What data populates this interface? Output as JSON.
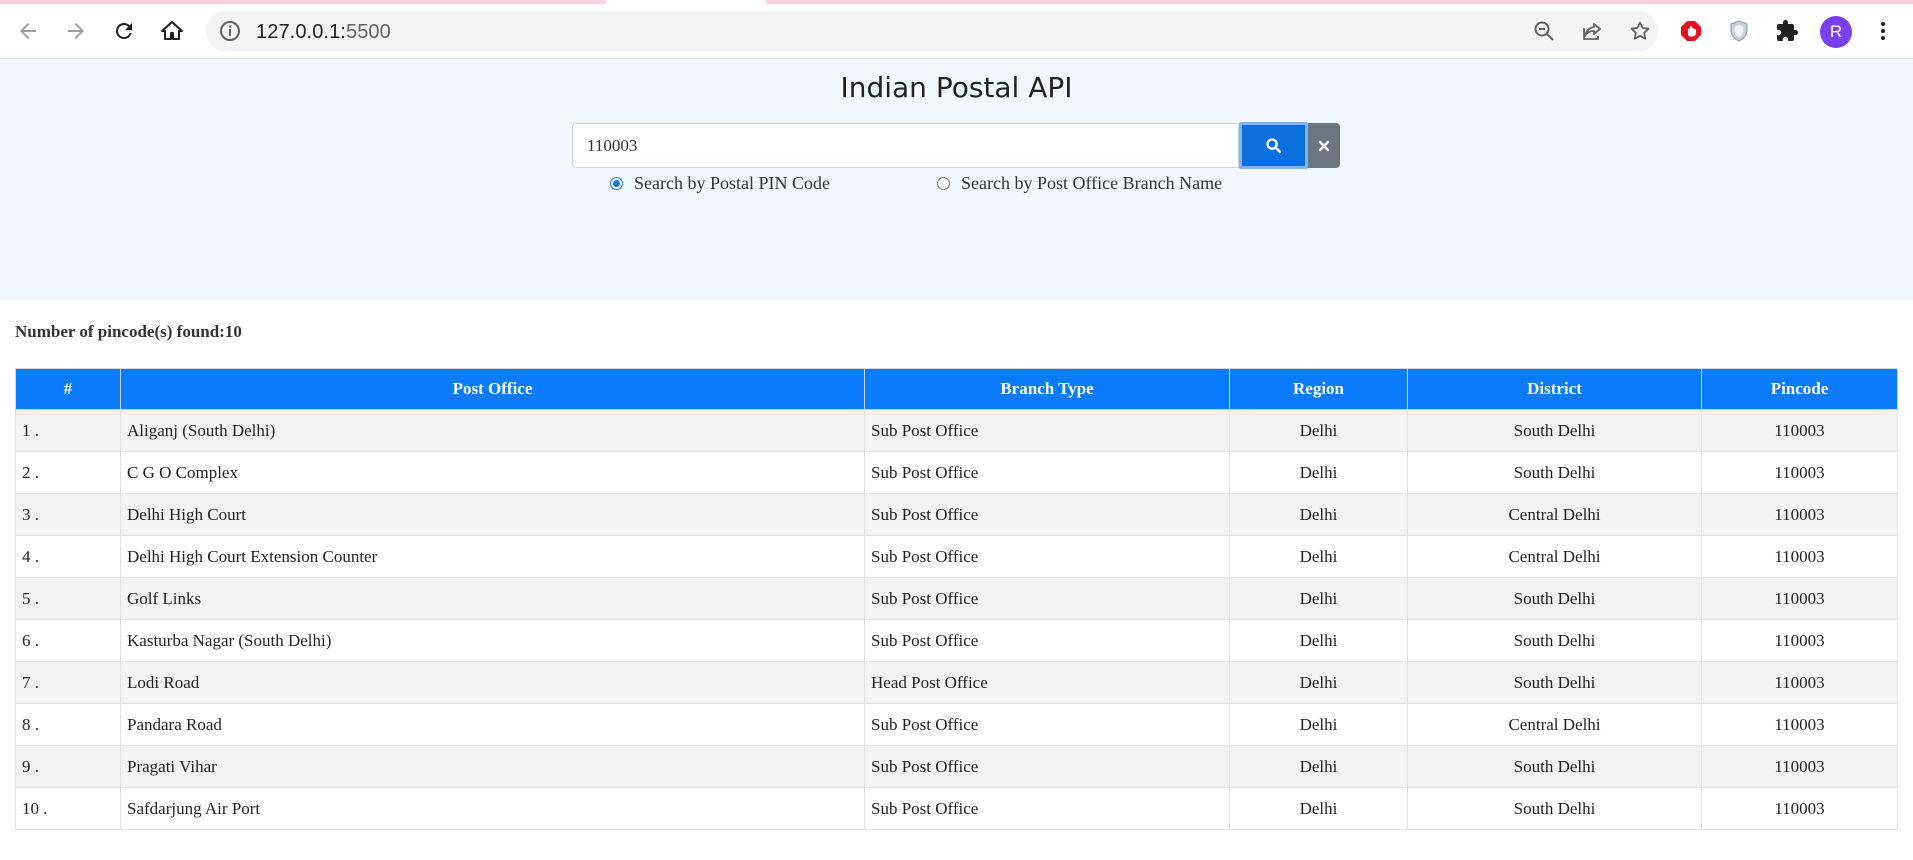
{
  "browser": {
    "url_host": "127.0.0.1:",
    "url_port": "5500",
    "profile_initial": "R",
    "icons": [
      "back-icon",
      "forward-icon",
      "reload-icon",
      "home-icon",
      "site-info-icon",
      "zoom-out-icon",
      "share-icon",
      "bookmark-star-icon",
      "adblock-icon",
      "shield-extension-icon",
      "extensions-puzzle-icon",
      "kebab-menu-icon"
    ],
    "avatar_color": "#7b3ff2"
  },
  "app": {
    "title": "Indian Postal API",
    "search": {
      "value": "110003",
      "placeholder": ""
    },
    "radio_options": [
      {
        "label": "Search by Postal PIN Code",
        "checked": true
      },
      {
        "label": "Search by Post Office Branch Name",
        "checked": false
      }
    ],
    "count_label": "Number of pincode(s) found:",
    "count_value": "10",
    "accent_color": "#0b7bfb"
  },
  "table": {
    "headers": [
      "#",
      "Post Office",
      "Branch Type",
      "Region",
      "District",
      "Pincode"
    ],
    "rows": [
      [
        "1 .",
        "Aliganj (South Delhi)",
        "Sub Post Office",
        "Delhi",
        "South Delhi",
        "110003"
      ],
      [
        "2 .",
        "C G O Complex",
        "Sub Post Office",
        "Delhi",
        "South Delhi",
        "110003"
      ],
      [
        "3 .",
        "Delhi High Court",
        "Sub Post Office",
        "Delhi",
        "Central Delhi",
        "110003"
      ],
      [
        "4 .",
        "Delhi High Court Extension Counter",
        "Sub Post Office",
        "Delhi",
        "Central Delhi",
        "110003"
      ],
      [
        "5 .",
        "Golf Links",
        "Sub Post Office",
        "Delhi",
        "South Delhi",
        "110003"
      ],
      [
        "6 .",
        "Kasturba Nagar (South Delhi)",
        "Sub Post Office",
        "Delhi",
        "South Delhi",
        "110003"
      ],
      [
        "7 .",
        "Lodi Road",
        "Head Post Office",
        "Delhi",
        "South Delhi",
        "110003"
      ],
      [
        "8 .",
        "Pandara Road",
        "Sub Post Office",
        "Delhi",
        "Central Delhi",
        "110003"
      ],
      [
        "9 .",
        "Pragati Vihar",
        "Sub Post Office",
        "Delhi",
        "South Delhi",
        "110003"
      ],
      [
        "10 .",
        "Safdarjung Air Port",
        "Sub Post Office",
        "Delhi",
        "South Delhi",
        "110003"
      ]
    ]
  }
}
